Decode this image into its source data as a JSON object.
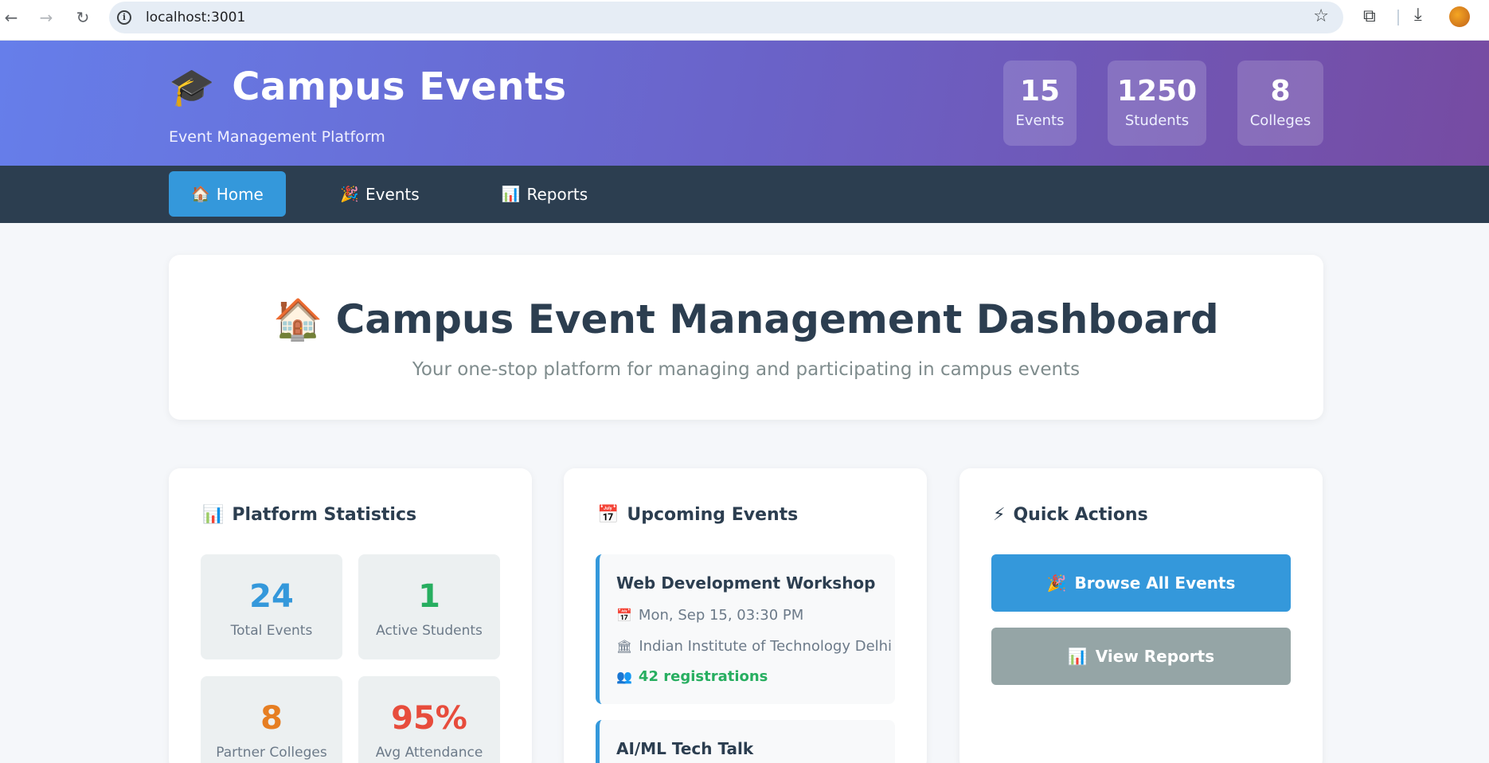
{
  "browser": {
    "url": "localhost:3001",
    "icons": {
      "back": "back-arrow-icon",
      "forward": "forward-arrow-icon",
      "reload": "reload-icon",
      "info": "site-info-icon",
      "star": "star-icon",
      "extensions": "extensions-icon",
      "download": "download-icon"
    }
  },
  "header": {
    "brand_icon": "🎓",
    "title": "Campus Events",
    "tagline": "Event Management Platform",
    "stats": [
      {
        "value": "15",
        "label": "Events"
      },
      {
        "value": "1250",
        "label": "Students"
      },
      {
        "value": "8",
        "label": "Colleges"
      }
    ]
  },
  "nav": {
    "items": [
      {
        "icon": "🏠",
        "label": "Home",
        "active": true
      },
      {
        "icon": "🎉",
        "label": "Events",
        "active": false
      },
      {
        "icon": "📊",
        "label": "Reports",
        "active": false
      }
    ]
  },
  "hero": {
    "icon": "🏠",
    "title": "Campus Event Management Dashboard",
    "subtitle": "Your one-stop platform for managing and participating in campus events"
  },
  "platform_stats": {
    "icon": "📊",
    "title": "Platform Statistics",
    "tiles": [
      {
        "value": "24",
        "label": "Total Events",
        "color": "#3498db"
      },
      {
        "value": "1",
        "label": "Active Students",
        "color": "#27ae60"
      },
      {
        "value": "8",
        "label": "Partner Colleges",
        "color": "#e67e22"
      },
      {
        "value": "95%",
        "label": "Avg Attendance",
        "color": "#e74c3c"
      }
    ]
  },
  "upcoming": {
    "icon": "📅",
    "title": "Upcoming Events",
    "events": [
      {
        "name": "Web Development Workshop",
        "date_icon": "📅",
        "date": "Mon, Sep 15, 03:30 PM",
        "venue_icon": "🏛",
        "venue": "Indian Institute of Technology Delhi",
        "reg_icon": "👥",
        "registrations": "42 registrations"
      },
      {
        "name": "AI/ML Tech Talk"
      }
    ]
  },
  "quick_actions": {
    "icon": "⚡",
    "title": "Quick Actions",
    "buttons": [
      {
        "icon": "🎉",
        "label": "Browse All Events",
        "color": "#3498db"
      },
      {
        "icon": "📊",
        "label": "View Reports",
        "color": "#95a5a6"
      }
    ]
  },
  "colors": {
    "primary": "#3498db",
    "header_start": "#667eea",
    "header_end": "#764ba2",
    "nav_bg": "#2c3e50"
  }
}
